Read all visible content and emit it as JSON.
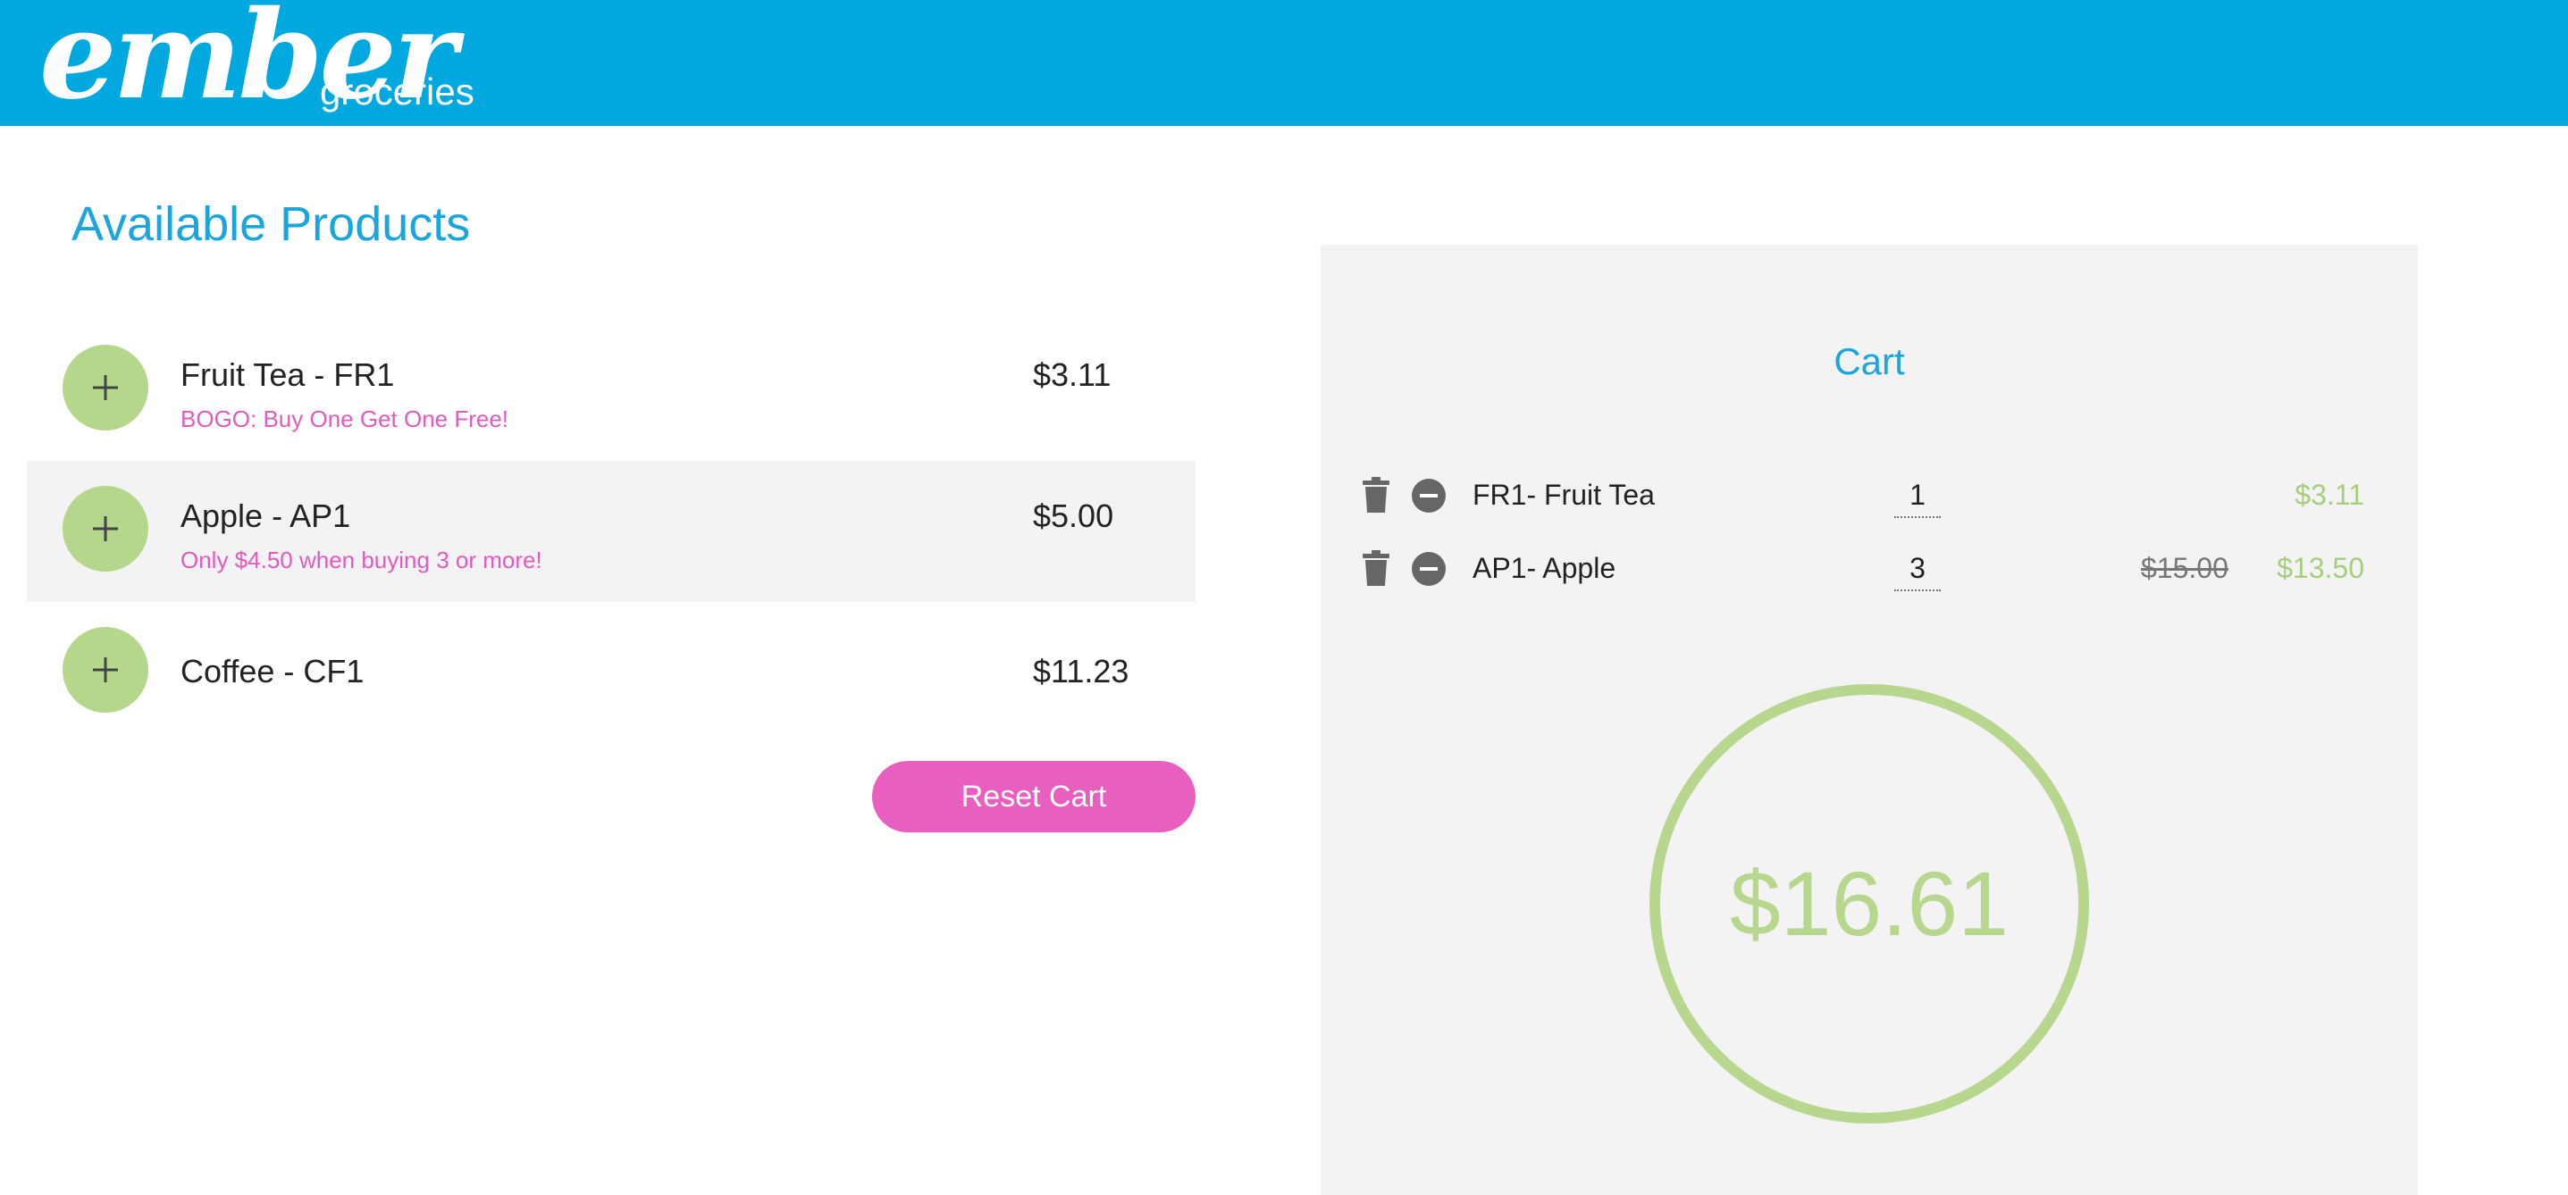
{
  "header": {
    "logo_text": "ember",
    "logo_subtitle": "groceries",
    "background_color": "#00a8e0"
  },
  "products": {
    "title": "Available Products",
    "items": [
      {
        "name": "Fruit Tea - FR1",
        "price": "$3.11",
        "promo": "BOGO: Buy One Get One Free!",
        "icon": "plus-icon"
      },
      {
        "name": "Apple - AP1",
        "price": "$5.00",
        "promo": "Only $4.50 when buying 3 or more!",
        "icon": "plus-icon"
      },
      {
        "name": "Coffee - CF1",
        "price": "$11.23",
        "promo": "",
        "icon": "plus-icon"
      }
    ],
    "reset_label": "Reset Cart",
    "add_button_color": "#b5d78c",
    "promo_color": "#e05bbf",
    "reset_button_color": "#e85fbf"
  },
  "cart": {
    "title": "Cart",
    "lines": [
      {
        "name": "FR1- Fruit Tea",
        "quantity": "1",
        "original_price": "",
        "price": "$3.11",
        "icons": [
          "trash-icon",
          "minus-circle-icon"
        ]
      },
      {
        "name": "AP1- Apple",
        "quantity": "3",
        "original_price": "$15.00",
        "price": "$13.50",
        "icons": [
          "trash-icon",
          "minus-circle-icon"
        ]
      }
    ],
    "total": "$16.61",
    "total_color": "#b7d78e",
    "panel_color": "#f3f3f3",
    "accent_color": "#1aa5dc"
  }
}
